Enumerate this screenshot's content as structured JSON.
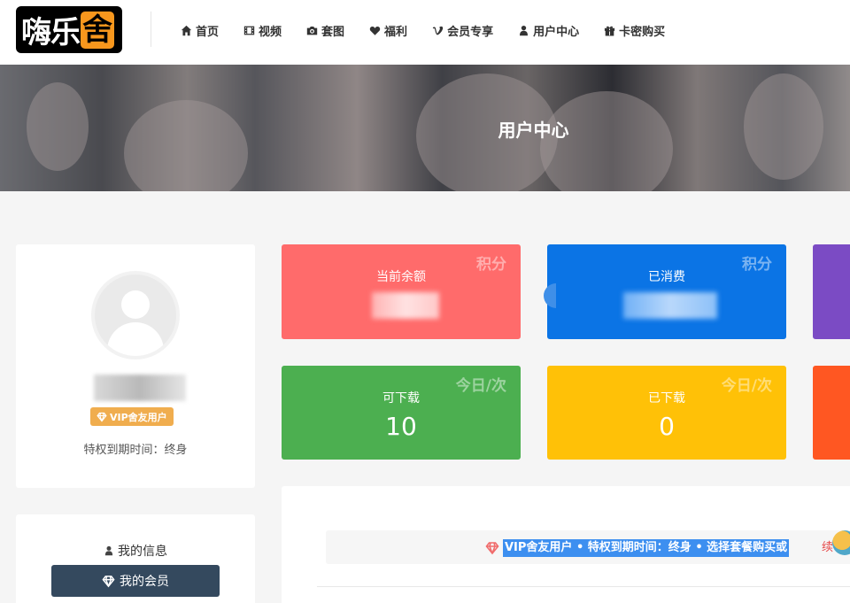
{
  "logo": {
    "part1": "嗨乐",
    "part2": "舍"
  },
  "nav": [
    {
      "label": "首页",
      "icon": "home-icon"
    },
    {
      "label": "视频",
      "icon": "film-icon"
    },
    {
      "label": "套图",
      "icon": "camera-icon"
    },
    {
      "label": "福利",
      "icon": "heart-icon"
    },
    {
      "label": "会员专享",
      "icon": "vimeo-v-icon"
    },
    {
      "label": "用户中心",
      "icon": "user-icon"
    },
    {
      "label": "卡密购买",
      "icon": "gift-icon"
    }
  ],
  "banner": {
    "title": "用户中心"
  },
  "profile": {
    "badge": "VIP舍友用户",
    "expire": "特权到期时间：终身"
  },
  "menu": {
    "my_info": "我的信息",
    "my_member": "我的会员"
  },
  "stats": [
    {
      "label": "当前余额",
      "tag": "积分",
      "color": "#ff6b6b"
    },
    {
      "label": "已消费",
      "tag": "积分",
      "color": "#0b74e5"
    },
    {
      "label": "可下载",
      "tag": "今日/次",
      "value": "10",
      "color": "#4caf50"
    },
    {
      "label": "已下载",
      "tag": "今日/次",
      "value": "0",
      "color": "#ffc107"
    }
  ],
  "notice": {
    "highlight": "VIP舍友用户 • 特权到期时间：终身 • 选择套餐购买或",
    "tail": "续"
  }
}
